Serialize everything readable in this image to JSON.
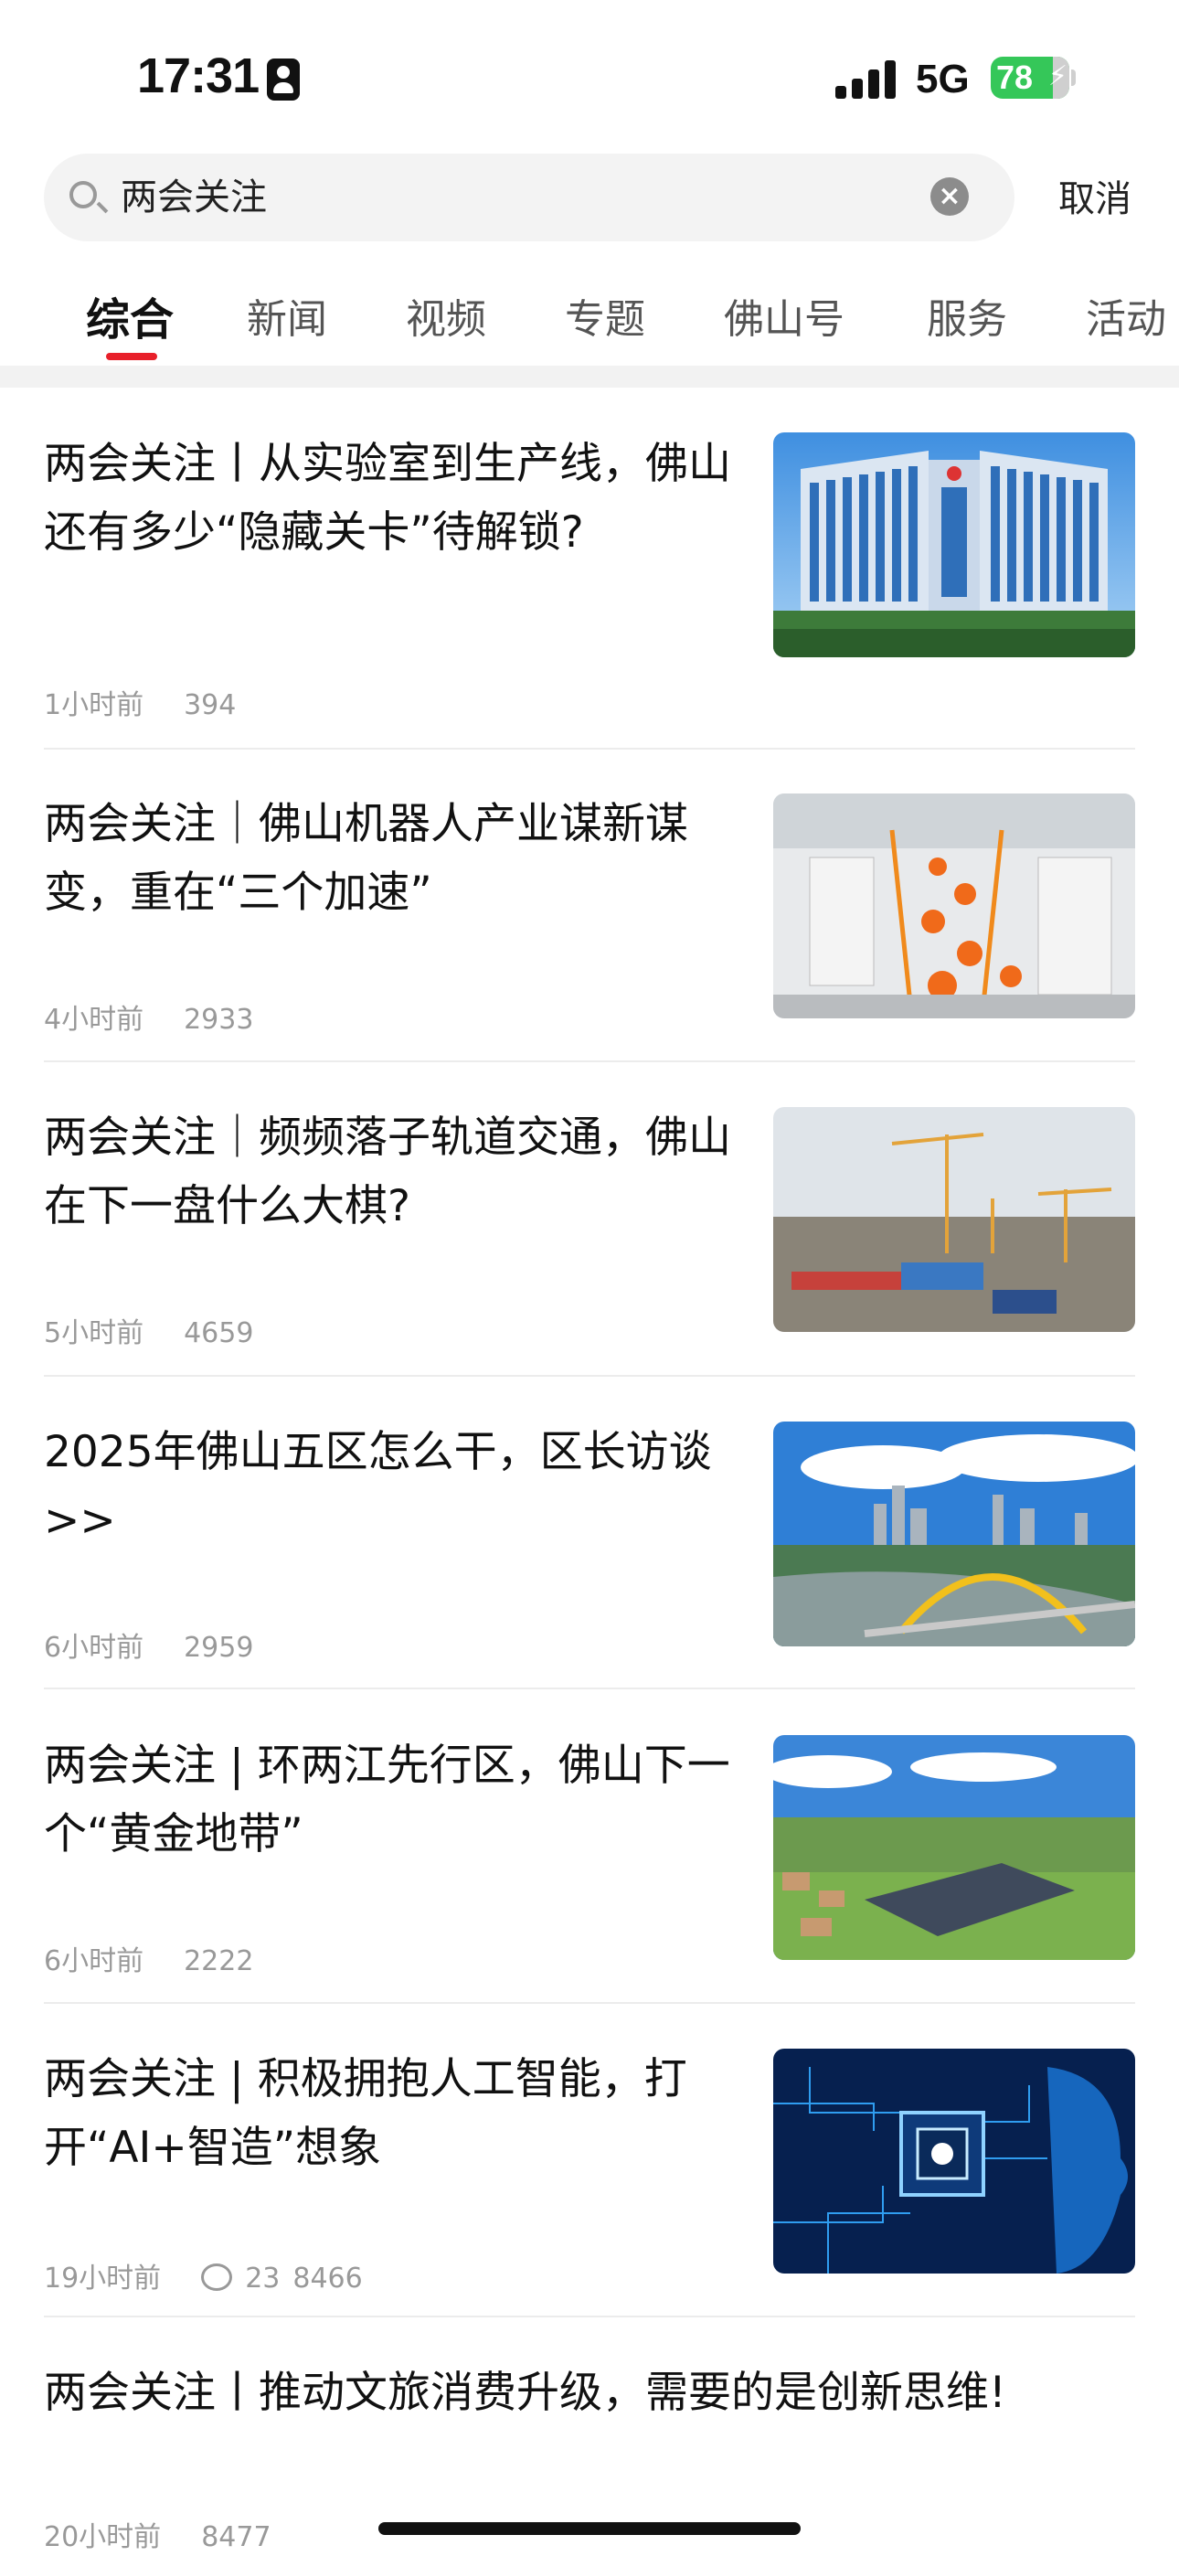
{
  "status_bar": {
    "time": "17:31",
    "network": "5G",
    "battery": "78",
    "battery_fill_fraction": 0.78
  },
  "search": {
    "query": "两会关注",
    "cancel_label": "取消"
  },
  "tabs": [
    {
      "label": "综合",
      "active": true
    },
    {
      "label": "新闻"
    },
    {
      "label": "视频"
    },
    {
      "label": "专题"
    },
    {
      "label": "佛山号"
    },
    {
      "label": "服务"
    },
    {
      "label": "活动"
    }
  ],
  "news": [
    {
      "title": "两会关注丨从实验室到生产线，佛山还有多少“隐藏关卡”待解锁?",
      "time": "1小时前",
      "views": "394",
      "image": "government-building-photo"
    },
    {
      "title": "两会关注｜佛山机器人产业谋新谋变，重在“三个加速”",
      "time": "4小时前",
      "views": "2933",
      "image": "robot-factory-photo"
    },
    {
      "title": "两会关注｜频频落子轨道交通，佛山在下一盘什么大棋?",
      "time": "5小时前",
      "views": "4659",
      "image": "construction-site-photo"
    },
    {
      "title": "2025年佛山五区怎么干，区长访谈>>",
      "time": "6小时前",
      "views": "2959",
      "image": "city-river-bridge-photo"
    },
    {
      "title": "两会关注 | 环两江先行区，佛山下一个“黄金地带”",
      "time": "6小时前",
      "views": "2222",
      "image": "farmland-greenhouse-photo"
    },
    {
      "title": "两会关注 | 积极拥抱人工智能，打开“AI+智造”想象",
      "time": "19小时前",
      "comments": "23",
      "views": "8466",
      "image": "ai-chip-head-photo"
    },
    {
      "title": "两会关注丨推动文旅消费升级，需要的是创新思维!",
      "time": "20小时前",
      "views": "8477"
    }
  ]
}
